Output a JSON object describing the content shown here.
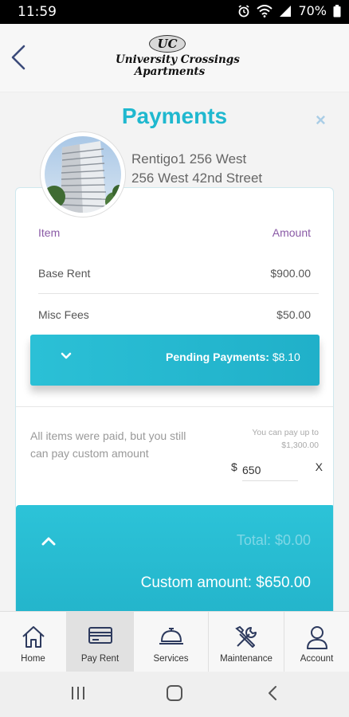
{
  "status_bar": {
    "time": "11:59",
    "battery": "70%"
  },
  "header": {
    "logo_mark": "UC",
    "logo_line1": "University Crossings",
    "logo_line2": "Apartments"
  },
  "page": {
    "title": "Payments",
    "close_symbol": "×"
  },
  "property": {
    "name": "Rentigo1 256 West",
    "street": "256 West 42nd Street"
  },
  "table": {
    "col_item": "Item",
    "col_amount": "Amount",
    "rows": [
      {
        "label": "Base Rent",
        "value": "$900.00"
      },
      {
        "label": "Misc Fees",
        "value": "$50.00"
      }
    ]
  },
  "pending": {
    "label": "Pending Payments:",
    "value": "$8.10"
  },
  "custom": {
    "message": "All items were paid, but you still can pay custom amount",
    "hint": "You can pay up to $1,300.00",
    "currency": "$",
    "amount_value": "650",
    "clear_label": "X"
  },
  "summary": {
    "total": "Total: $0.00",
    "custom_amount": "Custom amount: $650.00"
  },
  "nav": [
    {
      "label": "Home",
      "icon": "home-icon"
    },
    {
      "label": "Pay Rent",
      "icon": "credit-card-icon",
      "active": true
    },
    {
      "label": "Services",
      "icon": "service-bell-icon"
    },
    {
      "label": "Maintenance",
      "icon": "tools-icon"
    },
    {
      "label": "Account",
      "icon": "user-icon"
    }
  ],
  "colors": {
    "accent": "#1fb8cf",
    "header_purple": "#8a5aa6"
  }
}
